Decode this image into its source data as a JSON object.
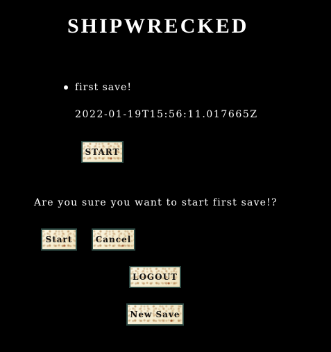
{
  "app": {
    "title": "SHIPWRECKED"
  },
  "saves": [
    {
      "name": "first save!",
      "timestamp": "2022-01-19T15:56:11.017665Z",
      "start_label": "START"
    }
  ],
  "confirm": {
    "message": "Are you sure you want to start first save!?",
    "start_label": "Start",
    "cancel_label": "Cancel"
  },
  "actions": {
    "logout_label": "LOGOUT",
    "new_save_label": "New Save"
  },
  "colors": {
    "background": "#000000",
    "text": "#ffffff",
    "button_face": "#f4ecd0",
    "button_border": "#2e4a44"
  }
}
